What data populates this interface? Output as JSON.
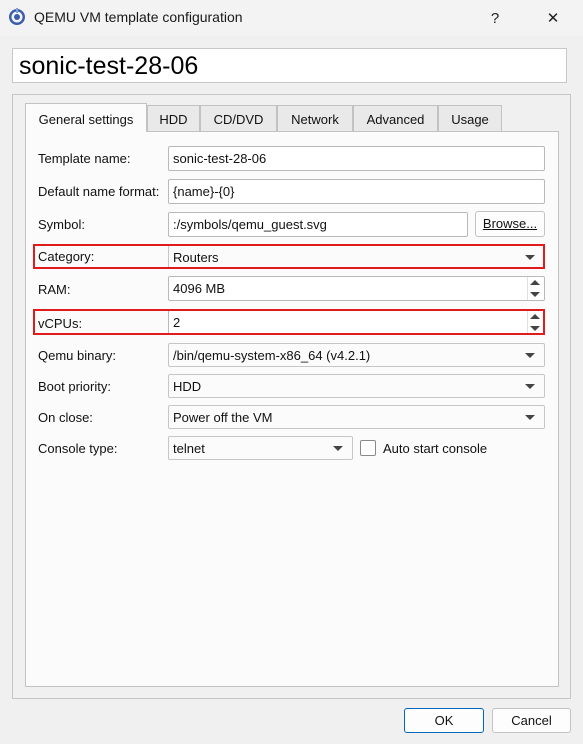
{
  "window": {
    "title": "QEMU VM template configuration",
    "help_glyph": "?",
    "close_glyph": "✕"
  },
  "template_title": "sonic-test-28-06",
  "tabs": [
    {
      "label": "General settings",
      "active": true
    },
    {
      "label": "HDD"
    },
    {
      "label": "CD/DVD"
    },
    {
      "label": "Network"
    },
    {
      "label": "Advanced"
    },
    {
      "label": "Usage"
    }
  ],
  "form": {
    "template_name": {
      "label": "Template name:",
      "value": "sonic-test-28-06"
    },
    "default_name_format": {
      "label": "Default name format:",
      "value": "{name}-{0}"
    },
    "symbol": {
      "label": "Symbol:",
      "value": ":/symbols/qemu_guest.svg",
      "browse_label": "Browse..."
    },
    "category": {
      "label": "Category:",
      "value": "Routers"
    },
    "ram": {
      "label": "RAM:",
      "value": "4096 MB"
    },
    "vcpus": {
      "label": "vCPUs:",
      "value": "2"
    },
    "qemu_binary": {
      "label": "Qemu binary:",
      "value": "/bin/qemu-system-x86_64 (v4.2.1)"
    },
    "boot_priority": {
      "label": "Boot priority:",
      "value": "HDD"
    },
    "on_close": {
      "label": "On close:",
      "value": "Power off the VM"
    },
    "console_type": {
      "label": "Console type:",
      "value": "telnet",
      "auto_start_label": "Auto start console",
      "auto_start_checked": false
    }
  },
  "buttons": {
    "ok": "OK",
    "cancel": "Cancel"
  },
  "colors": {
    "highlight": "#e01b1b",
    "ok_border": "#0067c0"
  }
}
